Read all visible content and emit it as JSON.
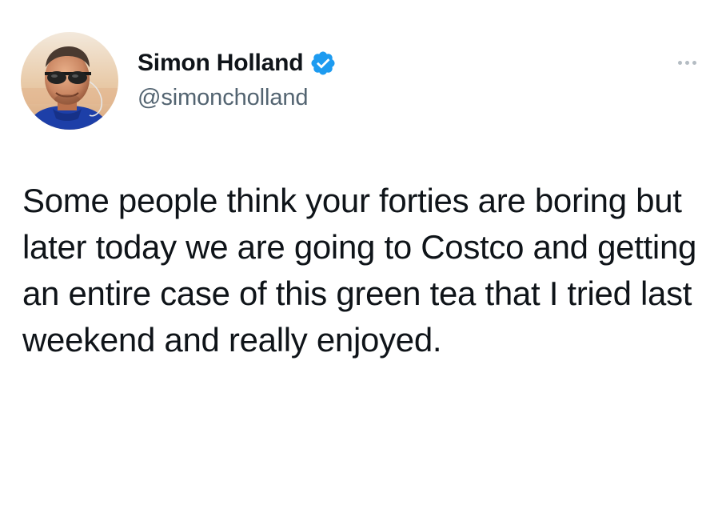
{
  "author": {
    "display_name": "Simon Holland",
    "handle": "@simoncholland",
    "verified": true,
    "avatar_icon": "profile-photo"
  },
  "tweet": {
    "text": "Some people think your forties are boring but later today we are going to Costco and getting an entire case of this green tea that I tried last weekend and really enjoyed."
  },
  "colors": {
    "text": "#0f1419",
    "secondary_text": "#536471",
    "verified_badge": "#1d9bf0",
    "more_dots": "#b4bcc3",
    "background": "#ffffff"
  },
  "icons": {
    "verified": "verified-badge-icon",
    "more": "more-options-icon"
  }
}
